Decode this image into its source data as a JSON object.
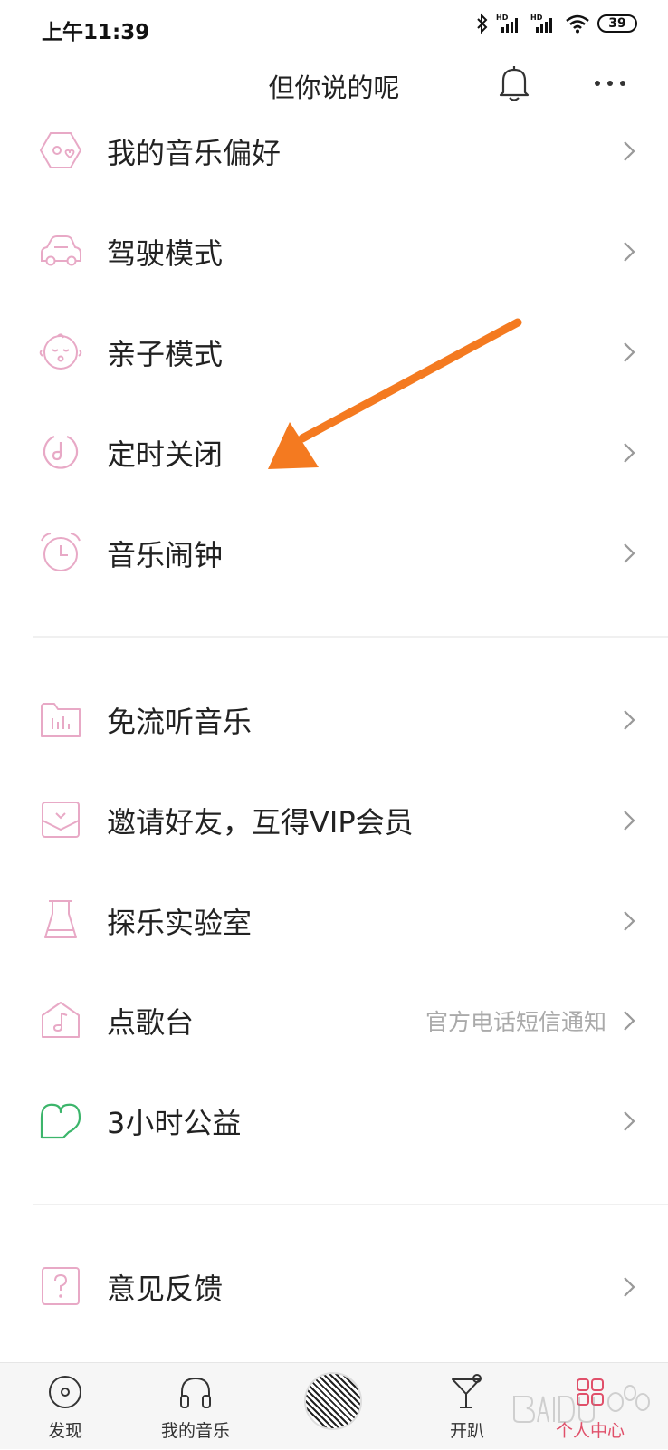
{
  "status": {
    "time": "上午11:39",
    "battery": "39"
  },
  "header": {
    "title": "但你说的呢"
  },
  "sections": [
    {
      "items": [
        {
          "label": "我的音乐偏好",
          "icon": "music-preference-icon"
        },
        {
          "label": "驾驶模式",
          "icon": "car-icon"
        },
        {
          "label": "亲子模式",
          "icon": "baby-face-icon"
        },
        {
          "label": "定时关闭",
          "icon": "timer-icon"
        },
        {
          "label": "音乐闹钟",
          "icon": "alarm-clock-icon"
        }
      ]
    },
    {
      "items": [
        {
          "label": "免流听音乐",
          "icon": "data-free-folder-icon"
        },
        {
          "label": "邀请好友，互得VIP会员",
          "icon": "invite-envelope-icon"
        },
        {
          "label": "探乐实验室",
          "icon": "lab-flask-icon"
        },
        {
          "label": "点歌台",
          "icon": "song-request-icon",
          "sub": "官方电话短信通知"
        },
        {
          "label": "3小时公益",
          "icon": "charity-heart-icon"
        }
      ]
    },
    {
      "items": [
        {
          "label": "意见反馈",
          "icon": "feedback-question-icon"
        }
      ]
    }
  ],
  "tabs": [
    {
      "label": "发现",
      "icon": "disc-icon"
    },
    {
      "label": "我的音乐",
      "icon": "headphones-icon"
    },
    {
      "label": "",
      "icon": "now-playing-disc-icon"
    },
    {
      "label": "开趴",
      "icon": "cocktail-icon"
    },
    {
      "label": "个人中心",
      "icon": "profile-grid-icon"
    }
  ],
  "colors": {
    "accent": "#e0506a",
    "icon_pink": "#e8a9c6",
    "icon_green": "#3cb56b",
    "arrow": "#f47a20"
  }
}
